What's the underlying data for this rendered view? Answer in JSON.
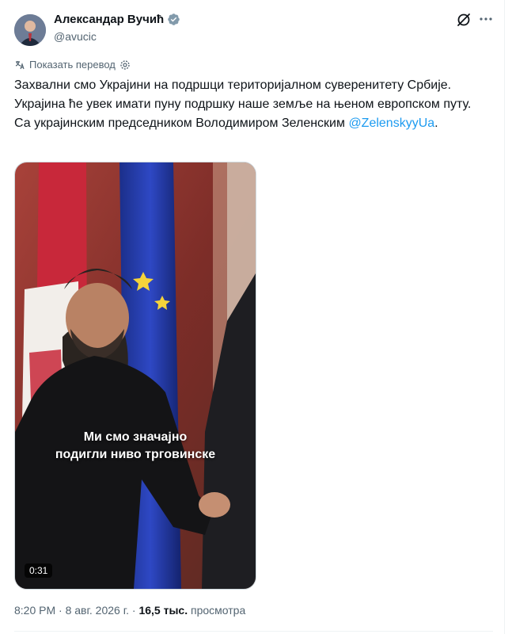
{
  "author": {
    "name": "Александар Вучић",
    "handle": "@avucic",
    "verified": true
  },
  "icons": {
    "grok": "grok-icon",
    "more": "more-icon",
    "translate_settings": "gear-icon",
    "verified": "verified-badge-icon"
  },
  "translate": {
    "label": "Показать перевод"
  },
  "tweet": {
    "line1": "Захвални смо Украјини на подршци територијалном суверенитету Србије.",
    "line2": "Украјина ће увек имати пуну подршку наше земље на њеном европском путу.",
    "line3_prefix": "Са украјинским председником Володимиром Зеленским ",
    "mention": "@ZelenskyyUa",
    "line3_suffix": "."
  },
  "media": {
    "caption_line1": "Ми смо значајно",
    "caption_line2": "подигли ниво трговинске",
    "duration": "0:31"
  },
  "meta": {
    "time": "8:20 PM",
    "separator": " · ",
    "date": "8 авг. 2026 г.",
    "views_count": "16,5 тыс.",
    "views_label": " просмотра"
  },
  "colors": {
    "link": "#1d9bf0",
    "secondary": "#536471",
    "primary_text": "#0f1419"
  }
}
